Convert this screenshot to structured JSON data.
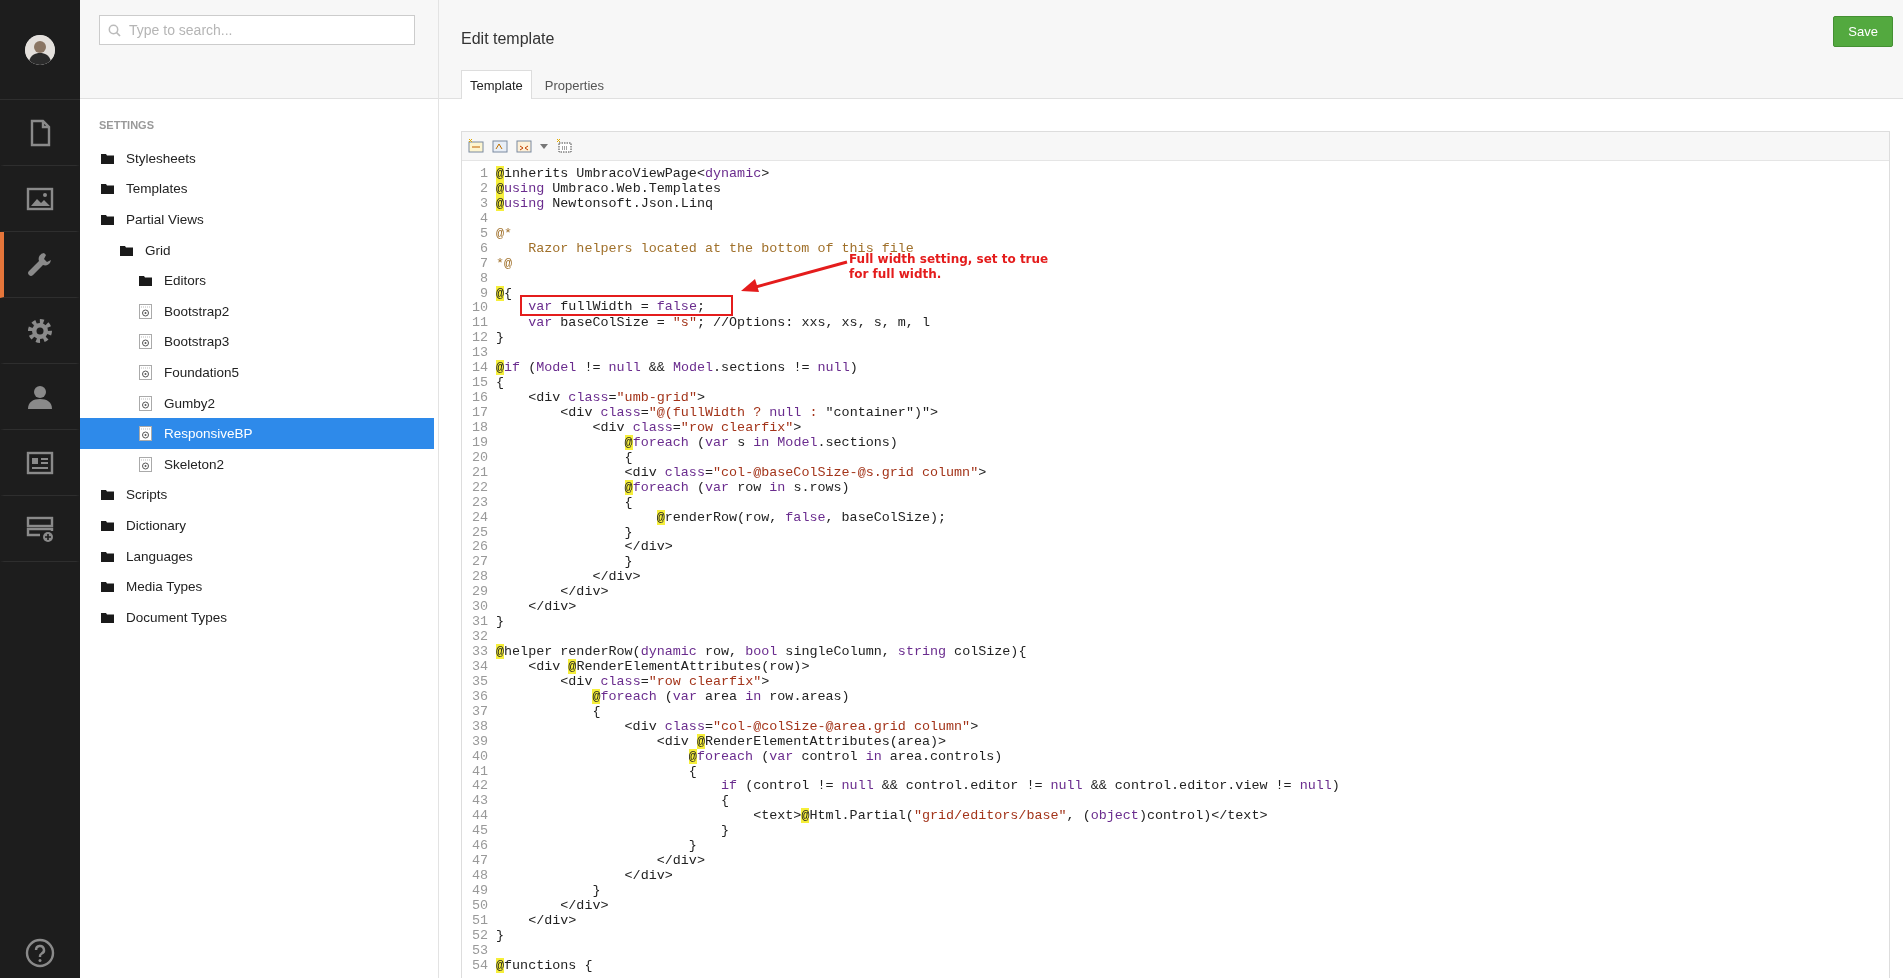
{
  "nav": {
    "items": [
      {
        "kind": "document",
        "selected": false
      },
      {
        "kind": "image",
        "selected": false
      },
      {
        "kind": "wrench",
        "selected": true
      },
      {
        "kind": "gear",
        "selected": false
      },
      {
        "kind": "person",
        "selected": false
      },
      {
        "kind": "card",
        "selected": false
      },
      {
        "kind": "server",
        "selected": false
      }
    ]
  },
  "tree": {
    "search": {
      "placeholder": "Type to search..."
    },
    "heading": "SETTINGS",
    "items": [
      {
        "label": "Stylesheets",
        "kind": "folder",
        "selected": false
      },
      {
        "label": "Templates",
        "kind": "folder",
        "selected": false
      },
      {
        "label": "Partial Views",
        "kind": "folder",
        "selected": false,
        "children": [
          {
            "label": "Grid",
            "kind": "folder",
            "selected": false,
            "children": [
              {
                "label": "Editors",
                "kind": "folder",
                "selected": false
              },
              {
                "label": "Bootstrap2",
                "kind": "file",
                "selected": false
              },
              {
                "label": "Bootstrap3",
                "kind": "file",
                "selected": false
              },
              {
                "label": "Foundation5",
                "kind": "file",
                "selected": false
              },
              {
                "label": "Gumby2",
                "kind": "file",
                "selected": false
              },
              {
                "label": "ResponsiveBP",
                "kind": "file",
                "selected": true
              },
              {
                "label": "Skeleton2",
                "kind": "file",
                "selected": false
              }
            ]
          }
        ]
      },
      {
        "label": "Scripts",
        "kind": "folder",
        "selected": false
      },
      {
        "label": "Dictionary",
        "kind": "folder",
        "selected": false
      },
      {
        "label": "Languages",
        "kind": "folder",
        "selected": false
      },
      {
        "label": "Media Types",
        "kind": "folder",
        "selected": false
      },
      {
        "label": "Document Types",
        "kind": "folder",
        "selected": false
      }
    ]
  },
  "editor": {
    "title": "Edit template",
    "save_button": "Save",
    "tabs": [
      {
        "label": "Template",
        "selected": true
      },
      {
        "label": "Properties",
        "selected": false
      }
    ],
    "annotation": {
      "text": "Full width setting, set to true for full width."
    },
    "lines": [
      {
        "num": "1",
        "tokens": [
          {
            "kind": "at",
            "text": "@"
          },
          {
            "kind": "plain",
            "text": "inherits UmbracoViewPage<"
          },
          {
            "kind": "kw",
            "text": "dynamic"
          },
          {
            "kind": "plain",
            "text": ">"
          }
        ]
      },
      {
        "num": "2",
        "tokens": [
          {
            "kind": "at",
            "text": "@"
          },
          {
            "kind": "kw",
            "text": "using"
          },
          {
            "kind": "plain",
            "text": " Umbraco.Web.Templates"
          }
        ]
      },
      {
        "num": "3",
        "tokens": [
          {
            "kind": "at",
            "text": "@"
          },
          {
            "kind": "kw",
            "text": "using"
          },
          {
            "kind": "plain",
            "text": " Newtonsoft.Json.Linq"
          }
        ]
      },
      {
        "num": "4"
      },
      {
        "num": "5",
        "tokens": [
          {
            "kind": "comment",
            "text": "@*"
          }
        ]
      },
      {
        "num": "6",
        "tokens": [
          {
            "kind": "comment",
            "text": "    Razor helpers located at the bottom of this file"
          }
        ]
      },
      {
        "num": "7",
        "tokens": [
          {
            "kind": "comment",
            "text": "*@"
          }
        ]
      },
      {
        "num": "8"
      },
      {
        "num": "9",
        "tokens": [
          {
            "kind": "at",
            "text": "@"
          },
          {
            "kind": "plain",
            "text": "{"
          }
        ]
      },
      {
        "num": "10",
        "tokens": [
          {
            "kind": "kw",
            "text": "    var"
          },
          {
            "kind": "plain",
            "text": " fullWidth = "
          },
          {
            "kind": "kw",
            "text": "false"
          },
          {
            "kind": "plain",
            "text": ";"
          }
        ]
      },
      {
        "num": "11",
        "tokens": [
          {
            "kind": "kw",
            "text": "    var"
          },
          {
            "kind": "plain",
            "text": " baseColSize = "
          },
          {
            "kind": "str",
            "text": "\"s\""
          },
          {
            "kind": "plain",
            "text": "; //Options: xxs, xs, s, m, l"
          }
        ]
      },
      {
        "num": "12",
        "tokens": [
          {
            "kind": "plain",
            "text": "}"
          }
        ]
      },
      {
        "num": "13"
      },
      {
        "num": "14",
        "tokens": [
          {
            "kind": "at",
            "text": "@"
          },
          {
            "kind": "kw",
            "text": "if"
          },
          {
            "kind": "plain",
            "text": " ("
          },
          {
            "kind": "kw",
            "text": "Model"
          },
          {
            "kind": "plain",
            "text": " != "
          },
          {
            "kind": "kw",
            "text": "null"
          },
          {
            "kind": "plain",
            "text": " && "
          },
          {
            "kind": "kw",
            "text": "Model"
          },
          {
            "kind": "plain",
            "text": ".sections != "
          },
          {
            "kind": "kw",
            "text": "null"
          },
          {
            "kind": "plain",
            "text": ")"
          }
        ]
      },
      {
        "num": "15",
        "tokens": [
          {
            "kind": "plain",
            "text": "{"
          }
        ]
      },
      {
        "num": "16",
        "tokens": [
          {
            "kind": "plain",
            "text": "    <div "
          },
          {
            "kind": "kw",
            "text": "class"
          },
          {
            "kind": "plain",
            "text": "="
          },
          {
            "kind": "str",
            "text": "\"umb-grid\""
          },
          {
            "kind": "plain",
            "text": ">"
          }
        ]
      },
      {
        "num": "17",
        "tokens": [
          {
            "kind": "plain",
            "text": "        <div "
          },
          {
            "kind": "kw",
            "text": "class"
          },
          {
            "kind": "plain",
            "text": "="
          },
          {
            "kind": "str",
            "text": "\"@(fullWidth ? "
          },
          {
            "kind": "kw",
            "text": "null"
          },
          {
            "kind": "str",
            "text": " : "
          },
          {
            "kind": "plain",
            "text": "\"container\")\">"
          }
        ]
      },
      {
        "num": "18",
        "tokens": [
          {
            "kind": "plain",
            "text": "            <div "
          },
          {
            "kind": "kw",
            "text": "class"
          },
          {
            "kind": "plain",
            "text": "="
          },
          {
            "kind": "str",
            "text": "\"row clearfix\""
          },
          {
            "kind": "plain",
            "text": ">"
          }
        ]
      },
      {
        "num": "19",
        "tokens": [
          {
            "kind": "at",
            "text": "                @"
          },
          {
            "kind": "kw",
            "text": "foreach"
          },
          {
            "kind": "plain",
            "text": " ("
          },
          {
            "kind": "kw",
            "text": "var"
          },
          {
            "kind": "plain",
            "text": " s "
          },
          {
            "kind": "kw",
            "text": "in"
          },
          {
            "kind": "kw",
            "text": " Model"
          },
          {
            "kind": "plain",
            "text": ".sections)"
          }
        ]
      },
      {
        "num": "20",
        "tokens": [
          {
            "kind": "plain",
            "text": "                {"
          }
        ]
      },
      {
        "num": "21",
        "tokens": [
          {
            "kind": "plain",
            "text": "                <div "
          },
          {
            "kind": "kw",
            "text": "class"
          },
          {
            "kind": "plain",
            "text": "="
          },
          {
            "kind": "str",
            "text": "\"col-@baseColSize-@s.grid column\""
          },
          {
            "kind": "plain",
            "text": ">"
          }
        ]
      },
      {
        "num": "22",
        "tokens": [
          {
            "kind": "at",
            "text": "                @"
          },
          {
            "kind": "kw",
            "text": "foreach"
          },
          {
            "kind": "plain",
            "text": " ("
          },
          {
            "kind": "kw",
            "text": "var"
          },
          {
            "kind": "plain",
            "text": " row "
          },
          {
            "kind": "kw",
            "text": "in"
          },
          {
            "kind": "plain",
            "text": " s.rows)"
          }
        ]
      },
      {
        "num": "23",
        "tokens": [
          {
            "kind": "plain",
            "text": "                {"
          }
        ]
      },
      {
        "num": "24",
        "tokens": [
          {
            "kind": "at",
            "text": "                    @"
          },
          {
            "kind": "plain",
            "text": "renderRow(row, "
          },
          {
            "kind": "kw",
            "text": "false"
          },
          {
            "kind": "plain",
            "text": ", baseColSize);"
          }
        ]
      },
      {
        "num": "25",
        "tokens": [
          {
            "kind": "plain",
            "text": "                }"
          }
        ]
      },
      {
        "num": "26",
        "tokens": [
          {
            "kind": "plain",
            "text": "                </div>"
          }
        ]
      },
      {
        "num": "27",
        "tokens": [
          {
            "kind": "plain",
            "text": "                }"
          }
        ]
      },
      {
        "num": "28",
        "tokens": [
          {
            "kind": "plain",
            "text": "            </div>"
          }
        ]
      },
      {
        "num": "29",
        "tokens": [
          {
            "kind": "plain",
            "text": "        </div>"
          }
        ]
      },
      {
        "num": "30",
        "tokens": [
          {
            "kind": "plain",
            "text": "    </div>"
          }
        ]
      },
      {
        "num": "31",
        "tokens": [
          {
            "kind": "plain",
            "text": "}"
          }
        ]
      },
      {
        "num": "32"
      },
      {
        "num": "33",
        "tokens": [
          {
            "kind": "at",
            "text": "@"
          },
          {
            "kind": "plain",
            "text": "helper renderRow("
          },
          {
            "kind": "kw",
            "text": "dynamic"
          },
          {
            "kind": "plain",
            "text": " row, "
          },
          {
            "kind": "kw",
            "text": "bool"
          },
          {
            "kind": "plain",
            "text": " singleColumn, "
          },
          {
            "kind": "kw",
            "text": "string"
          },
          {
            "kind": "plain",
            "text": " colSize){"
          }
        ]
      },
      {
        "num": "34",
        "tokens": [
          {
            "kind": "plain",
            "text": "    <div "
          },
          {
            "kind": "at",
            "text": "@"
          },
          {
            "kind": "plain",
            "text": "RenderElementAttributes(row)>"
          }
        ]
      },
      {
        "num": "35",
        "tokens": [
          {
            "kind": "plain",
            "text": "        <div "
          },
          {
            "kind": "kw",
            "text": "class"
          },
          {
            "kind": "plain",
            "text": "="
          },
          {
            "kind": "str",
            "text": "\"row clearfix\""
          },
          {
            "kind": "plain",
            "text": ">"
          }
        ]
      },
      {
        "num": "36",
        "tokens": [
          {
            "kind": "at",
            "text": "            @"
          },
          {
            "kind": "kw",
            "text": "foreach"
          },
          {
            "kind": "plain",
            "text": " ("
          },
          {
            "kind": "kw",
            "text": "var"
          },
          {
            "kind": "plain",
            "text": " area "
          },
          {
            "kind": "kw",
            "text": "in"
          },
          {
            "kind": "plain",
            "text": " row.areas)"
          }
        ]
      },
      {
        "num": "37",
        "tokens": [
          {
            "kind": "plain",
            "text": "            {"
          }
        ]
      },
      {
        "num": "38",
        "tokens": [
          {
            "kind": "plain",
            "text": "                <div "
          },
          {
            "kind": "kw",
            "text": "class"
          },
          {
            "kind": "plain",
            "text": "="
          },
          {
            "kind": "str",
            "text": "\"col-@colSize-@area.grid column\""
          },
          {
            "kind": "plain",
            "text": ">"
          }
        ]
      },
      {
        "num": "39",
        "tokens": [
          {
            "kind": "plain",
            "text": "                    <div "
          },
          {
            "kind": "at",
            "text": "@"
          },
          {
            "kind": "plain",
            "text": "RenderElementAttributes(area)>"
          }
        ]
      },
      {
        "num": "40",
        "tokens": [
          {
            "kind": "at",
            "text": "                        @"
          },
          {
            "kind": "kw",
            "text": "foreach"
          },
          {
            "kind": "plain",
            "text": " ("
          },
          {
            "kind": "kw",
            "text": "var"
          },
          {
            "kind": "plain",
            "text": " control "
          },
          {
            "kind": "kw",
            "text": "in"
          },
          {
            "kind": "plain",
            "text": " area.controls)"
          }
        ]
      },
      {
        "num": "41",
        "tokens": [
          {
            "kind": "plain",
            "text": "                        {"
          }
        ]
      },
      {
        "num": "42",
        "tokens": [
          {
            "kind": "kw",
            "text": "                            if"
          },
          {
            "kind": "plain",
            "text": " (control != "
          },
          {
            "kind": "kw",
            "text": "null"
          },
          {
            "kind": "plain",
            "text": " && control.editor != "
          },
          {
            "kind": "kw",
            "text": "null"
          },
          {
            "kind": "plain",
            "text": " && control.editor.view != "
          },
          {
            "kind": "kw",
            "text": "null"
          },
          {
            "kind": "plain",
            "text": ")"
          }
        ]
      },
      {
        "num": "43",
        "tokens": [
          {
            "kind": "plain",
            "text": "                            {"
          }
        ]
      },
      {
        "num": "44",
        "tokens": [
          {
            "kind": "plain",
            "text": "                                <text>"
          },
          {
            "kind": "at",
            "text": "@"
          },
          {
            "kind": "plain",
            "text": "Html.Partial("
          },
          {
            "kind": "str",
            "text": "\"grid/editors/base\""
          },
          {
            "kind": "plain",
            "text": ", ("
          },
          {
            "kind": "kw",
            "text": "object"
          },
          {
            "kind": "plain",
            "text": ")control)</text>"
          }
        ]
      },
      {
        "num": "45",
        "tokens": [
          {
            "kind": "plain",
            "text": "                            }"
          }
        ]
      },
      {
        "num": "46",
        "tokens": [
          {
            "kind": "plain",
            "text": "                        }"
          }
        ]
      },
      {
        "num": "47",
        "tokens": [
          {
            "kind": "plain",
            "text": "                    </div>"
          }
        ]
      },
      {
        "num": "48",
        "tokens": [
          {
            "kind": "plain",
            "text": "                </div>"
          }
        ]
      },
      {
        "num": "49",
        "tokens": [
          {
            "kind": "plain",
            "text": "            }"
          }
        ]
      },
      {
        "num": "50",
        "tokens": [
          {
            "kind": "plain",
            "text": "        </div>"
          }
        ]
      },
      {
        "num": "51",
        "tokens": [
          {
            "kind": "plain",
            "text": "    </div>"
          }
        ]
      },
      {
        "num": "52",
        "tokens": [
          {
            "kind": "plain",
            "text": "}"
          }
        ]
      },
      {
        "num": "53"
      },
      {
        "num": "54",
        "tokens": [
          {
            "kind": "at",
            "text": "@"
          },
          {
            "kind": "plain",
            "text": "functions {"
          }
        ]
      }
    ]
  }
}
